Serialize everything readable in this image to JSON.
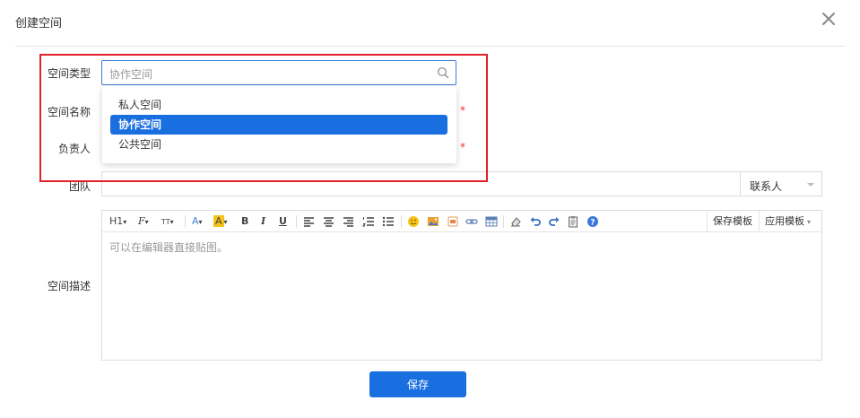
{
  "dialog": {
    "title": "创建空间"
  },
  "form": {
    "space_type": {
      "label": "空间类型",
      "value": "协作空间"
    },
    "space_name": {
      "label": "空间名称",
      "required_mark": "*"
    },
    "owner": {
      "label": "负责人",
      "required_mark": "*"
    },
    "team": {
      "label": "团队",
      "contact_select": "联系人"
    },
    "description": {
      "label": "空间描述",
      "placeholder": "可以在编辑器直接贴图。"
    }
  },
  "dropdown": {
    "items": [
      {
        "label": "私人空间",
        "selected": false
      },
      {
        "label": "协作空间",
        "selected": true
      },
      {
        "label": "公共空间",
        "selected": false
      }
    ]
  },
  "toolbar": {
    "heading": "H1",
    "font_family": "F",
    "font_size": "TT",
    "font_color": "A",
    "bg_color": "A",
    "bold": "B",
    "italic": "I",
    "underline": "U",
    "save_template": "保存模板",
    "apply_template": "应用模板"
  },
  "buttons": {
    "save": "保存"
  },
  "colors": {
    "primary": "#1a6fe0",
    "highlight": "#e0222a",
    "required": "#e33333"
  }
}
